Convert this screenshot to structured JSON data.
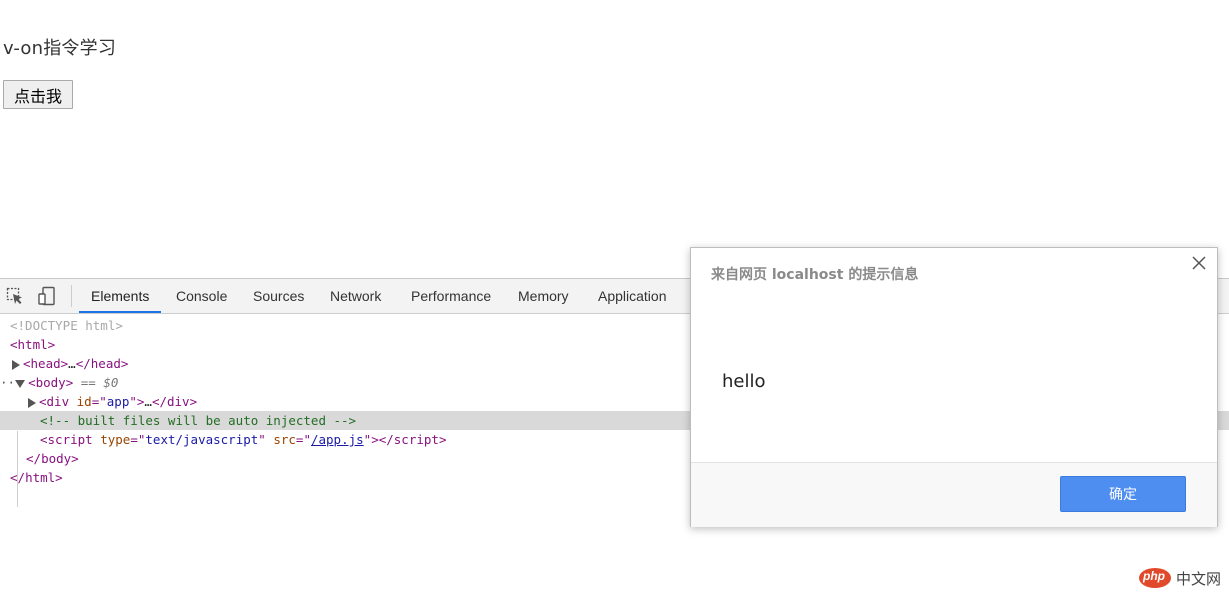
{
  "page": {
    "heading": "v-on指令学习",
    "button_label": "点击我"
  },
  "devtools": {
    "tabs": [
      "Elements",
      "Console",
      "Sources",
      "Network",
      "Performance",
      "Memory",
      "Application"
    ],
    "active_tab": "Elements",
    "dom": {
      "doctype": "<!DOCTYPE html>",
      "html_open": "html",
      "head": "head",
      "head_ellipsis": "…",
      "body": "body",
      "selected_marker": "== $0",
      "div_tag": "div",
      "div_attr": "id",
      "div_val": "app",
      "div_ellipsis": "…",
      "comment": "<!-- built files will be auto injected -->",
      "script_tag": "script",
      "script_attr1": "type",
      "script_val1": "text/javascript",
      "script_attr2": "src",
      "script_val2": "/app.js",
      "body_close": "body",
      "html_close": "html"
    }
  },
  "dialog": {
    "title": "来自网页 localhost 的提示信息",
    "message": "hello",
    "ok_label": "确定"
  },
  "watermark": {
    "logo_text": "php",
    "site_text": "中文网"
  },
  "icons": {
    "inspect": "cursor-select-icon",
    "device": "device-toggle-icon",
    "close": "close-icon"
  },
  "colors": {
    "accent_tab": "#1a73e8",
    "ok_button": "#4d8ef0",
    "tag": "#881280",
    "attr": "#994500",
    "value": "#1a1aa6",
    "comment": "#236e25"
  }
}
